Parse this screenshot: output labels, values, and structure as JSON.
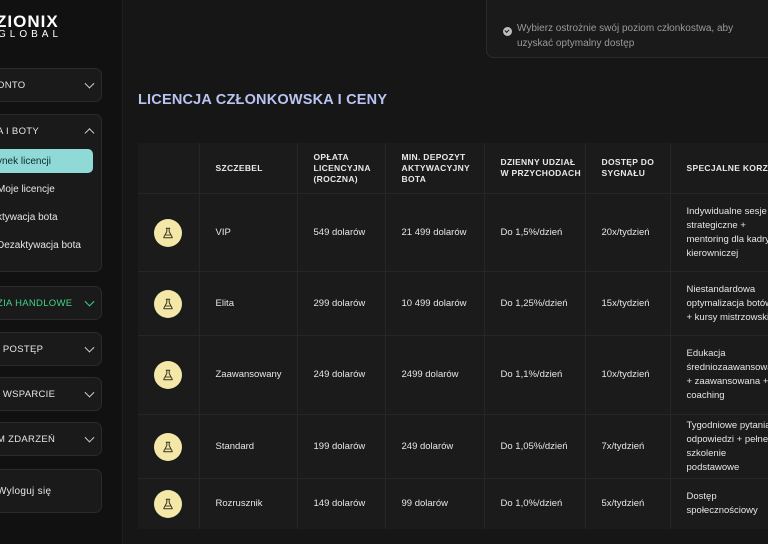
{
  "brand": {
    "name": "ZIONIX",
    "sub": "GLOBAL"
  },
  "sidebar": {
    "menus": [
      {
        "label": "ONTO",
        "expanded": false
      },
      {
        "label": "A I BOTY",
        "expanded": true,
        "items": [
          {
            "label": "ynek licencji",
            "active": true
          },
          {
            "label": "Moje licencje"
          },
          {
            "label": "ktywacja bota"
          },
          {
            "label": "Dezaktywacja bota"
          }
        ]
      },
      {
        "label": "ZIA HANDLOWE",
        "highlight": true
      },
      {
        "label": "I POSTĘP"
      },
      {
        "label": "I WSPARCIE"
      },
      {
        "label": "M ZDARZEŃ"
      },
      {
        "label": "Wyloguj się"
      }
    ]
  },
  "notice": {
    "text": "Wybierz ostrożnie swój poziom członkostwa, aby uzyskać optymalny dostęp",
    "icon": "check-circle-icon"
  },
  "page": {
    "title": "LICENCJA CZŁONKOWSKA I CENY"
  },
  "table": {
    "headers": [
      "",
      "SZCZEBEL",
      "OPŁATA LICENCYJNA (ROCZNA)",
      "MIN. DEPOZYT AKTYWACYJNY BOTA",
      "DZIENNY UDZIAŁ W PRZYCHODACH",
      "DOSTĘP DO SYGNAŁU",
      "SPECJALNE KORZYŚCI"
    ],
    "rows": [
      {
        "icon": "flask-icon",
        "tier": "VIP",
        "fee": "549 dolarów",
        "deposit": "21 499 dolarów",
        "share": "Do 1,5%/dzień",
        "signal": "20x/tydzień",
        "benefits": "Indywidualne sesje strategiczne + mentoring dla kadry kierowniczej"
      },
      {
        "icon": "flask-icon",
        "tier": "Elita",
        "fee": "299 dolarów",
        "deposit": "10 499 dolarów",
        "share": "Do 1,25%/dzień",
        "signal": "15x/tydzień",
        "benefits": "Niestandardowa optymalizacja botów + kursy mistrzowskie"
      },
      {
        "icon": "flask-icon",
        "tier": "Zaawansowany",
        "fee": "249 dolarów",
        "deposit": "2499 dolarów",
        "share": "Do 1,1%/dzień",
        "signal": "10x/tydzień",
        "benefits": "Edukacja średniozaawansowana + zaawansowana + coaching"
      },
      {
        "icon": "flask-icon",
        "tier": "Standard",
        "fee": "199 dolarów",
        "deposit": "249 dolarów",
        "share": "Do 1,05%/dzień",
        "signal": "7x/tydzień",
        "benefits": "Tygodniowe pytania i odpowiedzi + pełne szkolenie podstawowe"
      },
      {
        "icon": "flask-icon",
        "tier": "Rozrusznik",
        "fee": "149 dolarów",
        "deposit": "99 dolarów",
        "share": "Do 1,0%/dzień",
        "signal": "5x/tydzień",
        "benefits": "Dostęp społecznościowy"
      }
    ]
  },
  "colors": {
    "accent": "#b9c4f3",
    "active_item": "#8fd9d6",
    "highlight": "#3fd48a",
    "badge": "#f4e8a8"
  }
}
